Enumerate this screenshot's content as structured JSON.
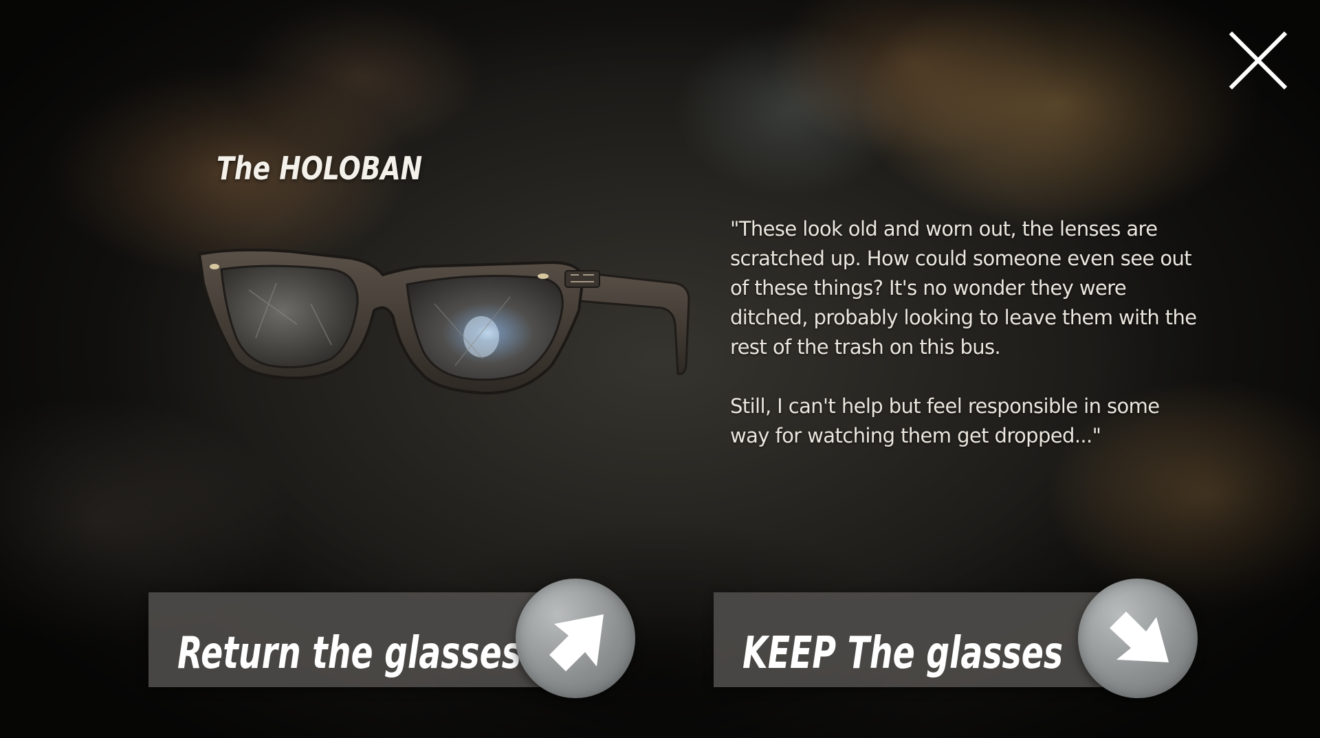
{
  "item": {
    "title_prefix": "The",
    "title_name": "HOLOBAN"
  },
  "description": {
    "paragraph_1": "\"These look old and worn out, the lenses are scratched up. How could someone even see out of these things? It's no wonder they were ditched, probably looking to leave them with the rest of the trash on this bus.",
    "paragraph_2": "Still, I can't help but feel responsible in some way for watching them get dropped...\""
  },
  "choices": {
    "return_label": "Return the glasses",
    "keep_label": "KEEP The glasses"
  },
  "icons": {
    "close": "close-icon",
    "return_arrow": "arrow-up-right-icon",
    "keep_arrow": "arrow-down-right-icon",
    "item_image": "glasses-icon"
  },
  "colors": {
    "button_bar": "#4e4c4a",
    "button_circle": "#8c9090",
    "text": "#ffffff"
  }
}
